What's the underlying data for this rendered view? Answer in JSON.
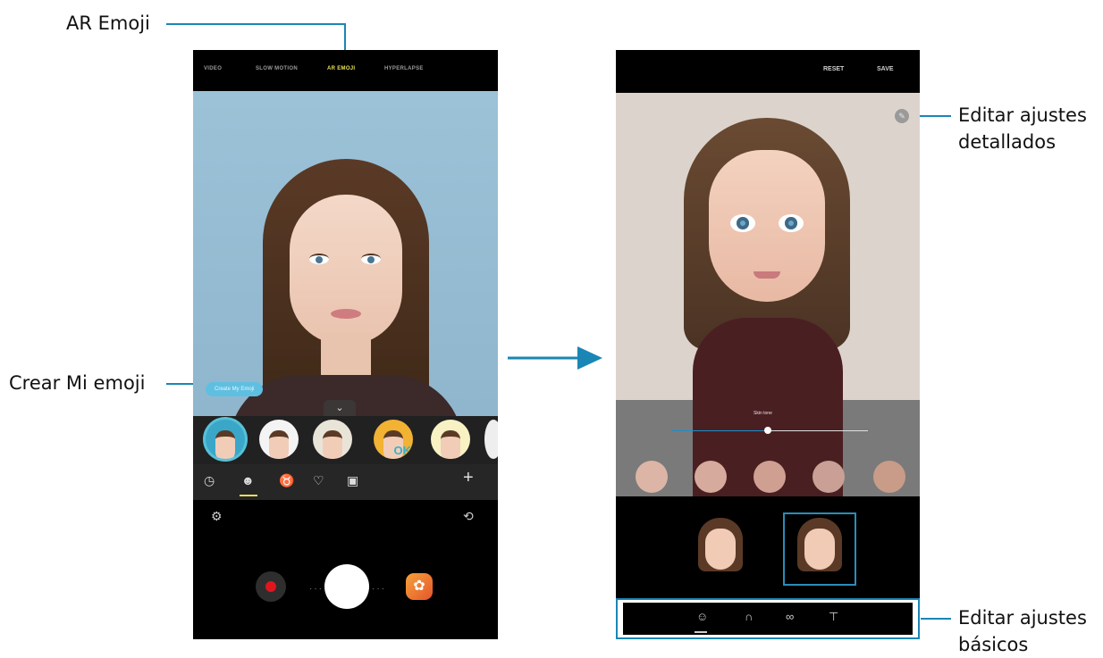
{
  "callouts": {
    "ar_emoji": "AR Emoji",
    "create_my_emoji": "Crear Mi emoji",
    "edit_detailed_line1": "Editar ajustes",
    "edit_detailed_line2": "detallados",
    "edit_basic_line1": "Editar ajustes",
    "edit_basic_line2": "básicos"
  },
  "phone1": {
    "modes": [
      "VIDEO",
      "SLOW MOTION",
      "AR EMOJI",
      "HYPERLAPSE"
    ],
    "active_mode": "AR EMOJI",
    "create_button": "Create My Emoji",
    "sticker_badge": "OK",
    "tab_icons": [
      "clock-icon",
      "avatar-icon",
      "mask-icon",
      "heart-icon",
      "sticker-icon",
      "plus-icon"
    ],
    "control_icons": [
      "settings-icon",
      "switch-camera-icon",
      "record-icon",
      "shutter-icon",
      "gallery-icon"
    ]
  },
  "phone2": {
    "reset": "RESET",
    "save": "SAVE",
    "slider_label": "Skin tone",
    "slider_value": 0.5,
    "skin_tones": [
      "#dcb5a6",
      "#d6aa9c",
      "#cfa091",
      "#caa096",
      "#c89c88"
    ],
    "bottom_tab_icons": [
      "face-icon",
      "hair-icon",
      "glasses-icon",
      "shirt-icon"
    ],
    "selected_model": 2
  },
  "colors": {
    "callout_line": "#1a86b6",
    "active_mode": "#e6e05a"
  }
}
